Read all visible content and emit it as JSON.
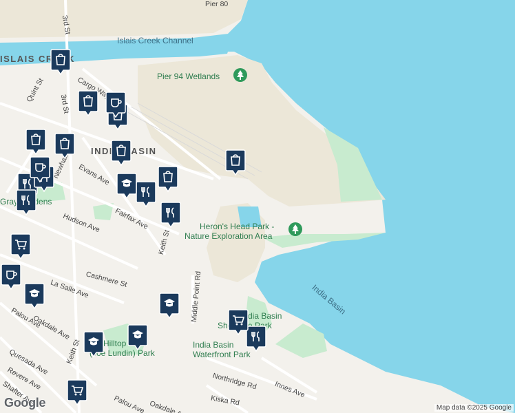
{
  "map": {
    "water_labels": [
      "Islais Creek Channel",
      "India Basin"
    ],
    "park_labels": [
      "Pier 94 Wetlands",
      "Heron's Head Park -",
      "Nature Exploration Area",
      "India Basin",
      "Shoreline Park",
      "India Basin",
      "Waterfront Park",
      "Hilltop",
      "(Joe Lundin) Park",
      "Gray Gardens"
    ],
    "area_labels": [
      "ISLAIS CREEK",
      "INDIA BASIN"
    ],
    "street_labels": [
      "Pier 80",
      "3rd St",
      "3rd St",
      "Quint St",
      "Cargo Way",
      "Newhall St",
      "Evans Ave",
      "Hudson Ave",
      "Fairfax Ave",
      "Keith St",
      "Cashmere St",
      "La Salle Ave",
      "Middle Point Rd",
      "Oakdale Ave",
      "Palou Ave",
      "Quesada Ave",
      "Revere Ave",
      "Shafter Ave",
      "Northridge Rd",
      "Innes Ave",
      "Kiska Rd",
      "Palou Ave",
      "Oakdale Ave",
      "Keith St"
    ],
    "attribution": "Map data ©2025 Google",
    "logo": "Google",
    "colors": {
      "water": "#86d5ea",
      "land": "#f3f1ec",
      "park": "#c8ebcf",
      "industrial": "#ece7d8",
      "pin": "#1b3a5c"
    }
  }
}
